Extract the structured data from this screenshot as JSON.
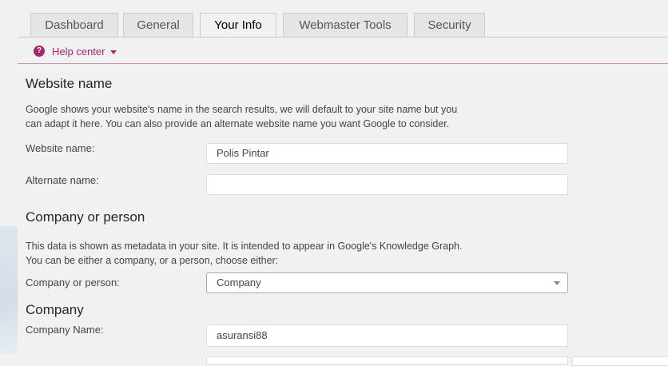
{
  "tabs": [
    {
      "label": "Dashboard",
      "active": false
    },
    {
      "label": "General",
      "active": false
    },
    {
      "label": "Your Info",
      "active": true
    },
    {
      "label": "Webmaster Tools",
      "active": false
    },
    {
      "label": "Security",
      "active": false
    }
  ],
  "help": {
    "label": "Help center",
    "icon": "question-circle-icon"
  },
  "website_section": {
    "title": "Website name",
    "description_line1": "Google shows your website's name in the search results, we will default to your site name but you",
    "description_line2": "can adapt it here. You can also provide an alternate website name you want Google to consider.",
    "website_name_label": "Website name:",
    "website_name_value": "Polis Pintar",
    "alternate_name_label": "Alternate name:",
    "alternate_name_value": ""
  },
  "company_person_section": {
    "title": "Company or person",
    "description_line1": "This data is shown as metadata in your site. It is intended to appear in Google's Knowledge Graph.",
    "description_line2": "You can be either a company, or a person, choose either:",
    "select_label": "Company or person:",
    "select_value": "Company"
  },
  "company_section": {
    "title": "Company",
    "company_name_label": "Company Name:",
    "company_name_value": "asuransi88"
  },
  "colors": {
    "accent": "#a4286a",
    "background": "#f1f1f1"
  }
}
